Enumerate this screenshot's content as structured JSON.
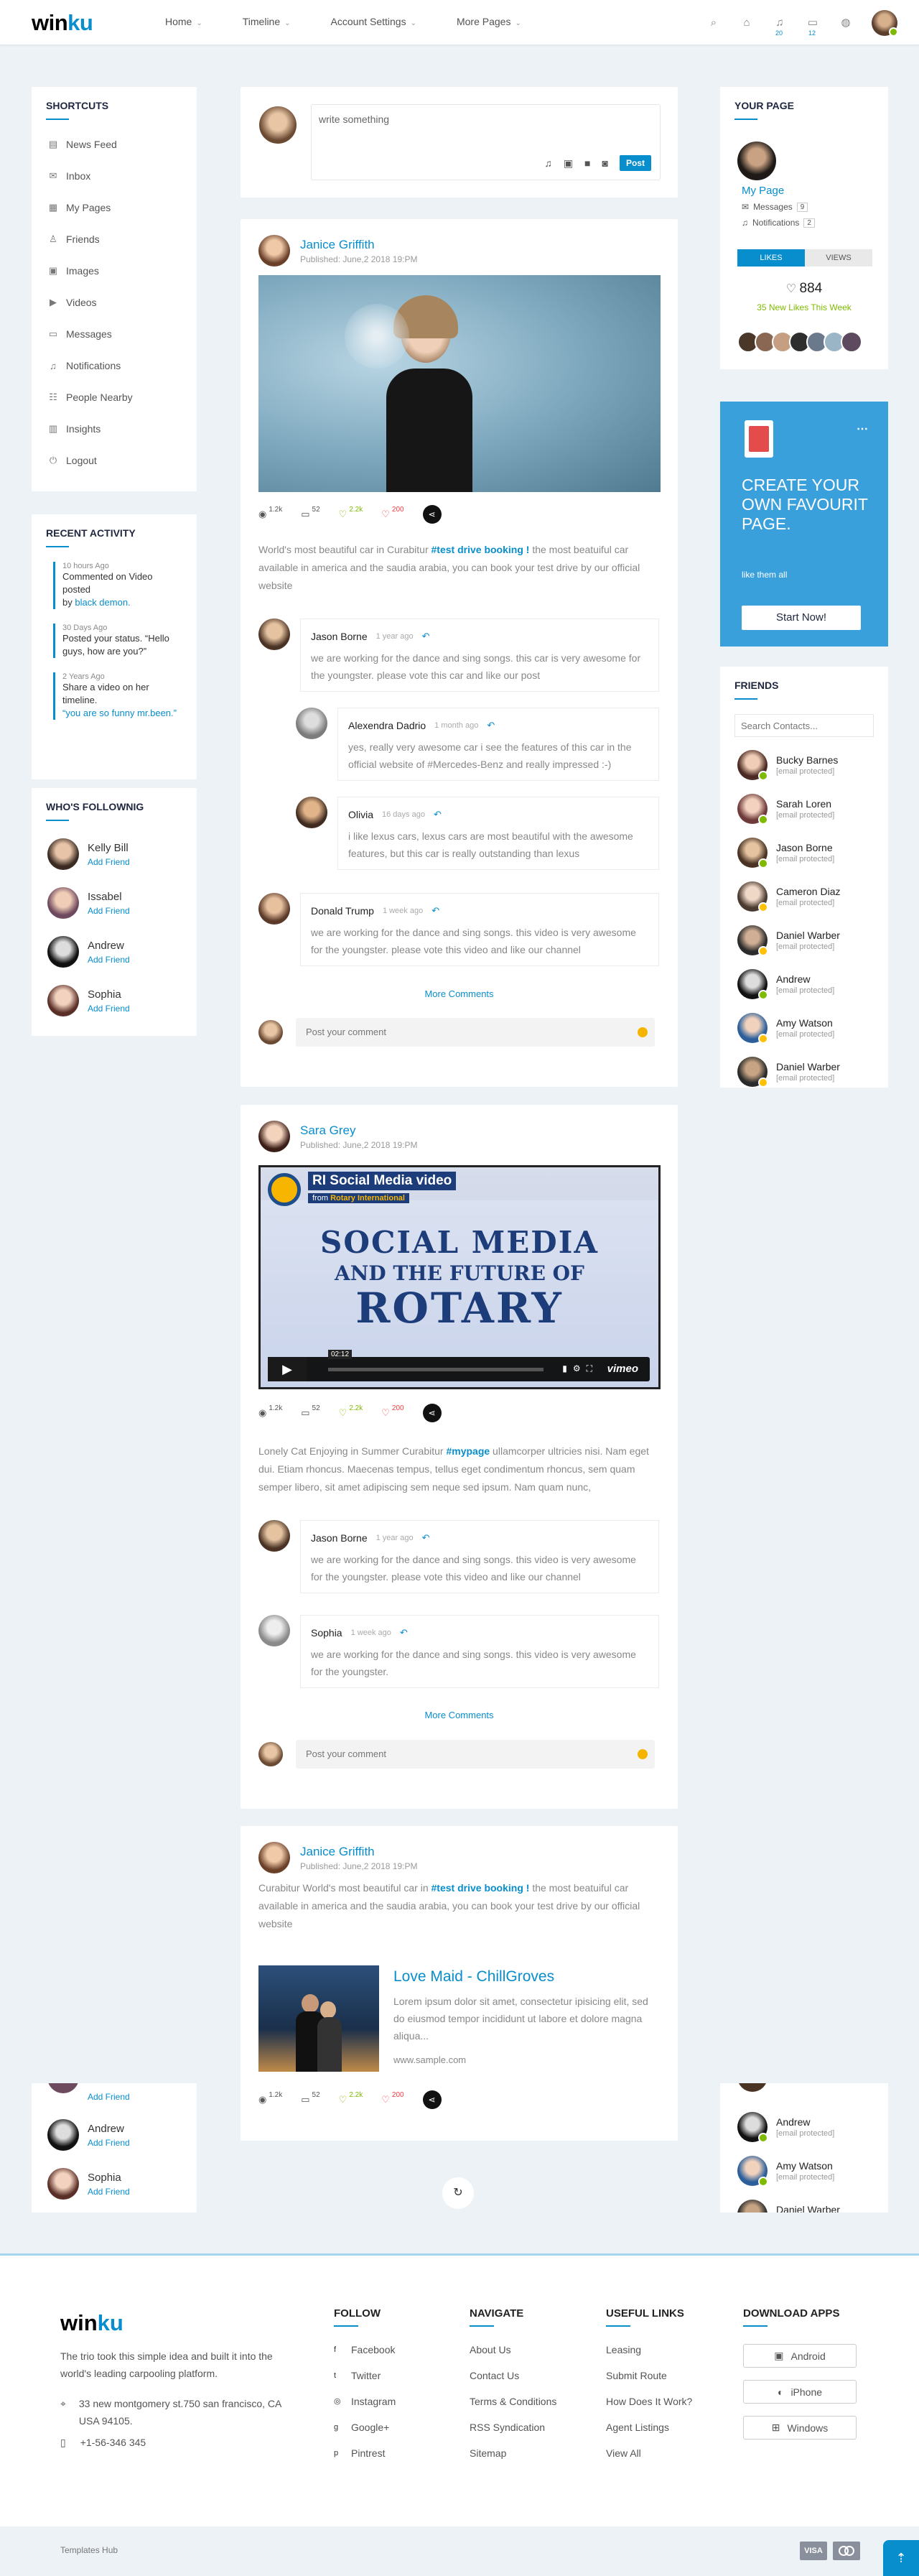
{
  "header": {
    "logo_main": "win",
    "logo_accent": "ku",
    "nav": [
      {
        "label": "Home"
      },
      {
        "label": "Timeline"
      },
      {
        "label": "Account Settings"
      },
      {
        "label": "More Pages"
      }
    ],
    "badge_msg": "20",
    "badge_chat": "12"
  },
  "shortcuts": {
    "title": "SHORTCUTS",
    "items": [
      {
        "label": "News Feed",
        "icon": "news-icon"
      },
      {
        "label": "Inbox",
        "icon": "inbox-icon"
      },
      {
        "label": "My Pages",
        "icon": "pages-icon"
      },
      {
        "label": "Friends",
        "icon": "friends-icon"
      },
      {
        "label": "Images",
        "icon": "images-icon"
      },
      {
        "label": "Videos",
        "icon": "videos-icon"
      },
      {
        "label": "Messages",
        "icon": "messages-icon"
      },
      {
        "label": "Notifications",
        "icon": "bell-icon"
      },
      {
        "label": "People Nearby",
        "icon": "people-icon"
      },
      {
        "label": "Insights",
        "icon": "chart-icon"
      },
      {
        "label": "Logout",
        "icon": "power-icon"
      }
    ]
  },
  "recent": {
    "title": "RECENT ACTIVITY",
    "items": [
      {
        "time": "10 hours Ago",
        "text": "Commented on Video posted",
        "by": "by ",
        "link": "black demon."
      },
      {
        "time": "30 Days Ago",
        "text": "Posted your status. “Hello guys, how are you?”",
        "by": "",
        "link": ""
      },
      {
        "time": "2 Years Ago",
        "text": "Share a video on her timeline.",
        "by": "",
        "link": "“you are so funny mr.been.”"
      }
    ]
  },
  "following": {
    "title": "WHO'S FOLLOWNIG",
    "add": "Add Friend",
    "items": [
      {
        "name": "Kelly Bill"
      },
      {
        "name": "Issabel"
      },
      {
        "name": "Andrew"
      },
      {
        "name": "Sophia"
      }
    ]
  },
  "following_bottom": {
    "add": "Add Friend",
    "items": [
      {
        "name": "Andrew"
      },
      {
        "name": "Sophia"
      }
    ]
  },
  "composer": {
    "placeholder": "write something",
    "button": "Post"
  },
  "post1": {
    "author": "Janice Griffith",
    "date": "Published: June,2 2018 19:PM",
    "views": "1.2k",
    "comments": "52",
    "likes": "2.2k",
    "dislikes": "200",
    "text_a": "World's most beautiful car in Curabitur ",
    "tag": "#test drive booking !",
    "text_b": " the most beatuiful car available in america and the saudia arabia, you can book your test drive by our official website",
    "comments_list": [
      {
        "name": "Jason Borne",
        "time": "1 year ago",
        "text": "we are working for the dance and sing songs. this car is very awesome for the youngster. please vote this car and like our post"
      },
      {
        "name": "Alexendra Dadrio",
        "time": "1 month ago",
        "text": "yes, really very awesome car i see the features of this car in the official website of #Mercedes-Benz and really impressed :-)"
      },
      {
        "name": "Olivia",
        "time": "16 days ago",
        "text": "i like lexus cars, lexus cars are most beautiful with the awesome features, but this car is really outstanding than lexus"
      },
      {
        "name": "Donald Trump",
        "time": "1 week ago",
        "text": "we are working for the dance and sing songs. this video is very awesome for the youngster. please vote this video and like our channel"
      }
    ],
    "more": "More Comments",
    "comment_placeholder": "Post your comment"
  },
  "post2": {
    "author": "Sara Grey",
    "date": "Published: June,2 2018 19:PM",
    "video_title": "RI Social Media video",
    "video_from": "from",
    "video_org": "Rotary International",
    "video_line1": "SOCIAL MEDIA",
    "video_line2": "AND THE FUTURE OF",
    "video_line3": "ROTARY",
    "video_time": "02:12",
    "video_brand": "vimeo",
    "views": "1.2k",
    "comments": "52",
    "likes": "2.2k",
    "dislikes": "200",
    "text_a": "Lonely Cat Enjoying in Summer Curabitur ",
    "tag": "#mypage",
    "text_b": " ullamcorper ultricies nisi. Nam eget dui. Etiam rhoncus. Maecenas tempus, tellus eget condimentum rhoncus, sem quam semper libero, sit amet adipiscing sem neque sed ipsum. Nam quam nunc,",
    "comments_list": [
      {
        "name": "Jason Borne",
        "time": "1 year ago",
        "text": "we are working for the dance and sing songs. this video is very awesome for the youngster. please vote this video and like our channel"
      },
      {
        "name": "Sophia",
        "time": "1 week ago",
        "text": "we are working for the dance and sing songs. this video is very awesome for the youngster."
      }
    ],
    "more": "More Comments",
    "comment_placeholder": "Post your comment"
  },
  "post3": {
    "author": "Janice Griffith",
    "date": "Published: June,2 2018 19:PM",
    "text_a": "Curabitur World's most beautiful car in ",
    "tag": "#test drive booking !",
    "text_b": " the most beatuiful car available in america and the saudia arabia, you can book your test drive by our official website",
    "link_title": "Love Maid - ChillGroves",
    "link_text": "Lorem ipsum dolor sit amet, consectetur ipisicing elit, sed do eiusmod tempor incididunt ut labore et dolore magna aliqua...",
    "link_url": "www.sample.com",
    "views": "1.2k",
    "comments": "52",
    "likes": "2.2k",
    "dislikes": "200"
  },
  "yourpage": {
    "title": "YOUR PAGE",
    "name": "My Page",
    "messages": "Messages",
    "messages_count": "9",
    "notifications": "Notifications",
    "notifications_count": "2",
    "tab_likes": "LIKES",
    "tab_views": "VIEWS",
    "likes_count": "884",
    "new_likes": "35 New Likes This Week"
  },
  "promo": {
    "title": "CREATE YOUR OWN FAVOURIT PAGE.",
    "sub": "like them all",
    "button": "Start Now!"
  },
  "friends": {
    "title": "FRIENDS",
    "search_placeholder": "Search Contacts...",
    "email": "[email protected]",
    "items": [
      {
        "name": "Bucky Barnes"
      },
      {
        "name": "Sarah Loren"
      },
      {
        "name": "Jason Borne"
      },
      {
        "name": "Cameron Diaz"
      },
      {
        "name": "Daniel Warber"
      },
      {
        "name": "Andrew"
      },
      {
        "name": "Amy Watson"
      },
      {
        "name": "Daniel Warber"
      }
    ]
  },
  "friends_bottom": {
    "email": "[email protected]",
    "items": [
      {
        "name": "Andrew"
      },
      {
        "name": "Amy Watson"
      },
      {
        "name": "Daniel Warber"
      }
    ]
  },
  "footer": {
    "logo_main": "win",
    "logo_accent": "ku",
    "about": "The trio took this simple idea and built it into the world's leading carpooling platform.",
    "address": "33 new montgomery st.750 san francisco, CA USA 94105.",
    "phone": "+1-56-346 345",
    "follow_title": "FOLLOW",
    "follow": [
      {
        "label": "Facebook"
      },
      {
        "label": "Twitter"
      },
      {
        "label": "Instagram"
      },
      {
        "label": "Google+"
      },
      {
        "label": "Pintrest"
      }
    ],
    "navigate_title": "NAVIGATE",
    "navigate": [
      {
        "label": "About Us"
      },
      {
        "label": "Contact Us"
      },
      {
        "label": "Terms & Conditions"
      },
      {
        "label": "RSS Syndication"
      },
      {
        "label": "Sitemap"
      }
    ],
    "useful_title": "USEFUL LINKS",
    "useful": [
      {
        "label": "Leasing"
      },
      {
        "label": "Submit Route"
      },
      {
        "label": "How Does It Work?"
      },
      {
        "label": "Agent Listings"
      },
      {
        "label": "View All"
      }
    ],
    "apps_title": "DOWNLOAD APPS",
    "apps": [
      {
        "label": "Android"
      },
      {
        "label": "iPhone"
      },
      {
        "label": "Windows"
      }
    ]
  },
  "bottom": {
    "credit": "Templates Hub",
    "visa": "VISA"
  }
}
